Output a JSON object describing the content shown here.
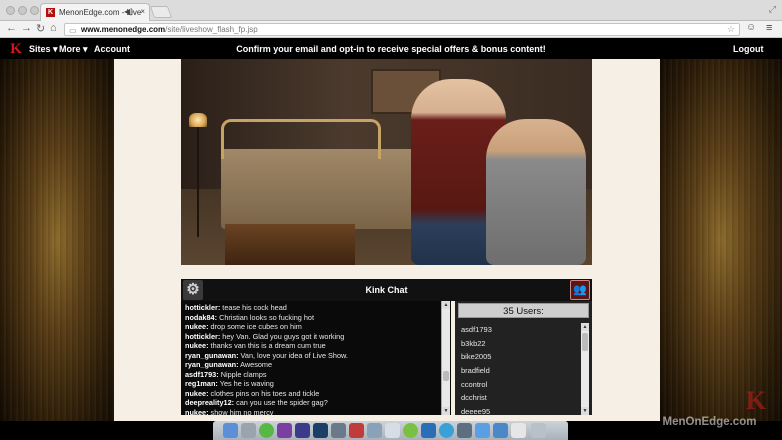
{
  "browser": {
    "tab_title": "MenonEdge.com - Live",
    "tab_favicon_glyph": "K",
    "tab_audio_glyph": "◀)",
    "tab_close_glyph": "×",
    "url_host": "www.menonedge.com",
    "url_path": "/site/liveshow_flash_fp.jsp",
    "icons": {
      "back": "back-arrow-icon",
      "forward": "forward-arrow-icon",
      "reload": "reload-icon",
      "home": "home-icon",
      "star": "star-icon",
      "menu": "hamburger-menu-icon"
    }
  },
  "site_nav": {
    "logo_glyph": "K",
    "sites_label": "Sites ▾",
    "more_label": "More ▾",
    "account_label": "Account",
    "promo_text": "Confirm your email and opt-in to receive special offers & bonus content!",
    "logout_label": "Logout"
  },
  "chat": {
    "title": "Kink Chat",
    "users_count": "35 Users:",
    "messages": [
      {
        "user": "hottickler:",
        "text": " tease his cock head"
      },
      {
        "user": "nodak84:",
        "text": " Christian looks so fucking hot"
      },
      {
        "user": "nukee:",
        "text": " drop some ice cubes on him"
      },
      {
        "user": "hottickler:",
        "text": " hey Van.  Glad you guys got it working"
      },
      {
        "user": "nukee:",
        "text": " thanks van this is a dream cum true"
      },
      {
        "user": "ryan_gunawan:",
        "text": " Van, love your idea of Live Show."
      },
      {
        "user": "ryan_gunawan:",
        "text": " Awesome"
      },
      {
        "user": "asdf1793:",
        "text": " Nipple clamps"
      },
      {
        "user": "reg1man:",
        "text": " Yes he is waving"
      },
      {
        "user": "nukee:",
        "text": " clothes pins on his toes and tickle"
      },
      {
        "user": "deepreality12:",
        "text": " can you use the spider gag?"
      },
      {
        "user": "nukee:",
        "text": " show him no mercy"
      }
    ],
    "users": [
      "asdf1793",
      "b3kb22",
      "bike2005",
      "bradfield",
      "ccontrol",
      "dcchrist",
      "deeee95"
    ]
  },
  "watermark": {
    "text": "MenOnEdge.com",
    "logo_glyph": "K"
  },
  "colors": {
    "brand_red": "#d01818",
    "content_bg": "#f6efe6",
    "nav_bg": "#000000"
  }
}
